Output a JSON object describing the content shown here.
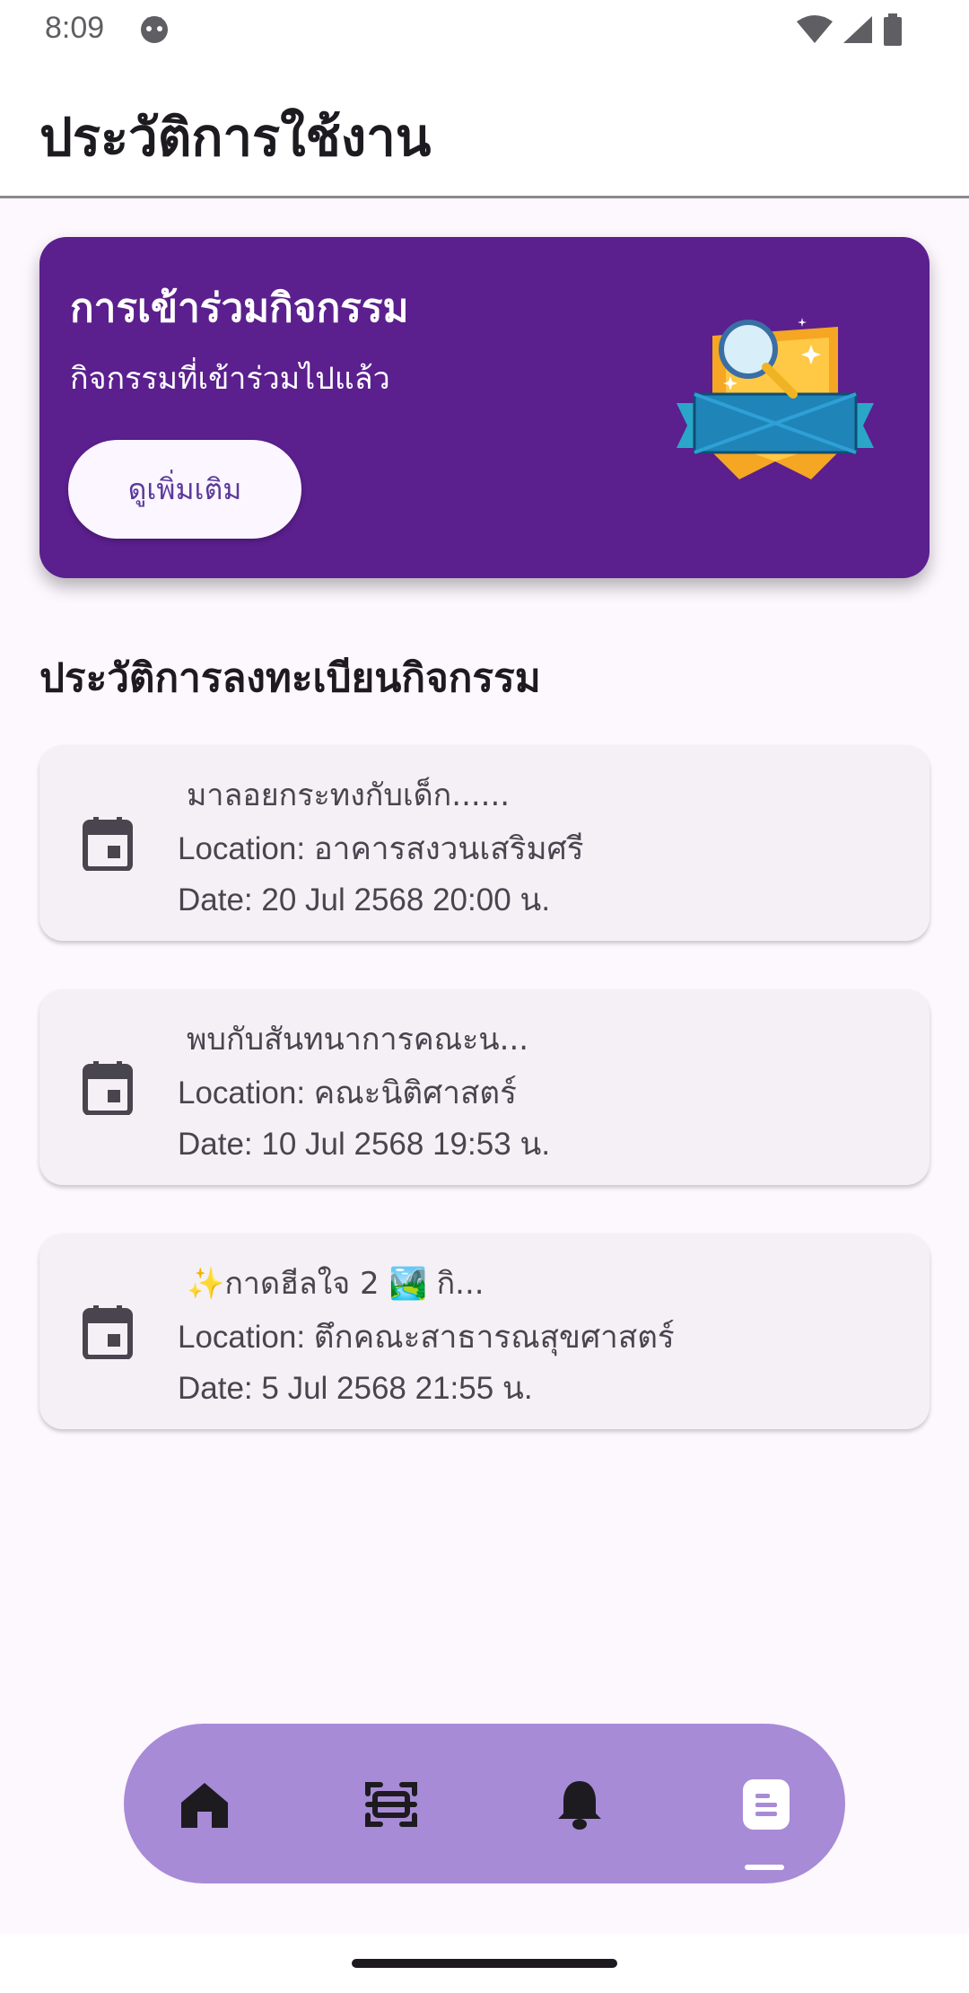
{
  "status_bar": {
    "time": "8:09",
    "icons": [
      "face-icon",
      "wifi-icon",
      "signal-icon",
      "battery-icon"
    ]
  },
  "app_bar": {
    "title": "ประวัติการใช้งาน"
  },
  "banner": {
    "title": "การเข้าร่วมกิจกรรม",
    "subtitle": "กิจกรรมที่เข้าร่วมไปแล้ว",
    "button_label": "ดูเพิ่มเติม",
    "background_color": "#5b1f8e"
  },
  "section": {
    "title": "ประวัติการลงทะเบียนกิจกรรม"
  },
  "history": [
    {
      "title": "มาลอยกระทงกับเด็ก......",
      "location": "Location: อาคารสงวนเสริมศรี",
      "date": "Date: 20 Jul 2568 20:00 น."
    },
    {
      "title": "พบกับสันทนาการคณะน...",
      "location": "Location: คณะนิติศาสตร์",
      "date": "Date: 10 Jul 2568 19:53 น."
    },
    {
      "title": "✨กาดฮีลใจ 2 🏞️ กิ...",
      "location": "Location: ตึกคณะสาธารณสุขศาสตร์",
      "date": "Date: 5 Jul 2568 21:55 น."
    }
  ],
  "bottom_nav": {
    "items": [
      "home-icon",
      "scan-icon",
      "bell-icon",
      "history-icon"
    ],
    "active": "history-icon",
    "background_color": "#a78bd6"
  }
}
